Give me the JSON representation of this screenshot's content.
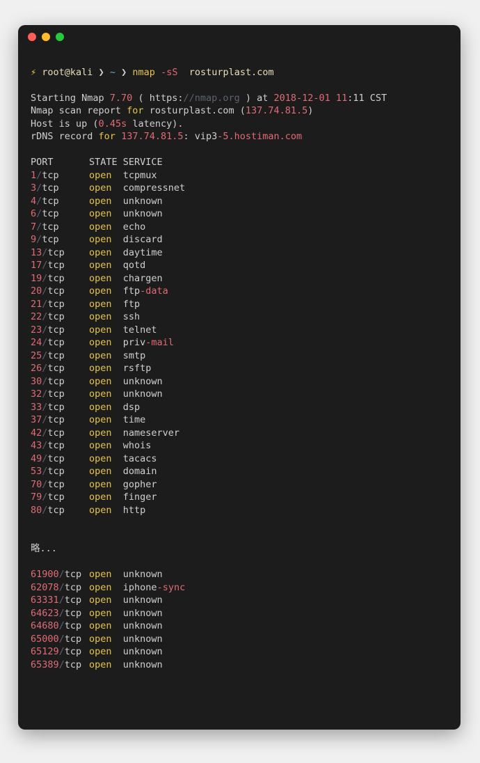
{
  "prompt": {
    "bolt": "⚡",
    "userhost": "root@kali",
    "sep1": "❯",
    "cwd": "~",
    "sep2": "❯",
    "cmd_base": "nmap",
    "cmd_flag": "-sS",
    "cmd_target": "rosturplast.com"
  },
  "header": {
    "l1a": "Starting Nmap ",
    "l1b": "7.70",
    "l1c": " ( https:",
    "l1d": "//nmap.org",
    "l1e": " ) at ",
    "l1f": "2018-12-01 11",
    "l1g": ":11 CST",
    "l2a": "Nmap scan report ",
    "l2b": "for",
    "l2c": " rosturplast.com (",
    "l2d": "137.74.81.5",
    "l2e": ")",
    "l3a": "Host is up (",
    "l3b": "0",
    "l3c": ".45s",
    "l3d": " latency).",
    "l4a": "rDNS record ",
    "l4b": "for",
    "l4c": " ",
    "l4d": "137.74.81.5",
    "l4e": ": vip3",
    "l4f": "-5.hostiman.com"
  },
  "columns": {
    "port": "PORT",
    "state": "STATE",
    "service": "SERVICE"
  },
  "ports_top": [
    {
      "num": "1",
      "proto": "tcp",
      "state": "open",
      "service": "tcpmux"
    },
    {
      "num": "3",
      "proto": "tcp",
      "state": "open",
      "service": "compressnet"
    },
    {
      "num": "4",
      "proto": "tcp",
      "state": "open",
      "service": "unknown"
    },
    {
      "num": "6",
      "proto": "tcp",
      "state": "open",
      "service": "unknown"
    },
    {
      "num": "7",
      "proto": "tcp",
      "state": "open",
      "service": "echo"
    },
    {
      "num": "9",
      "proto": "tcp",
      "state": "open",
      "service": "discard"
    },
    {
      "num": "13",
      "proto": "tcp",
      "state": "open",
      "service": "daytime"
    },
    {
      "num": "17",
      "proto": "tcp",
      "state": "open",
      "service": "qotd"
    },
    {
      "num": "19",
      "proto": "tcp",
      "state": "open",
      "service": "chargen"
    },
    {
      "num": "20",
      "proto": "tcp",
      "state": "open",
      "service": "ftp-data",
      "svc_a": "ftp",
      "svc_b": "-data"
    },
    {
      "num": "21",
      "proto": "tcp",
      "state": "open",
      "service": "ftp"
    },
    {
      "num": "22",
      "proto": "tcp",
      "state": "open",
      "service": "ssh"
    },
    {
      "num": "23",
      "proto": "tcp",
      "state": "open",
      "service": "telnet"
    },
    {
      "num": "24",
      "proto": "tcp",
      "state": "open",
      "service": "priv-mail",
      "svc_a": "priv",
      "svc_b": "-mail"
    },
    {
      "num": "25",
      "proto": "tcp",
      "state": "open",
      "service": "smtp"
    },
    {
      "num": "26",
      "proto": "tcp",
      "state": "open",
      "service": "rsftp"
    },
    {
      "num": "30",
      "proto": "tcp",
      "state": "open",
      "service": "unknown"
    },
    {
      "num": "32",
      "proto": "tcp",
      "state": "open",
      "service": "unknown"
    },
    {
      "num": "33",
      "proto": "tcp",
      "state": "open",
      "service": "dsp"
    },
    {
      "num": "37",
      "proto": "tcp",
      "state": "open",
      "service": "time"
    },
    {
      "num": "42",
      "proto": "tcp",
      "state": "open",
      "service": "nameserver"
    },
    {
      "num": "43",
      "proto": "tcp",
      "state": "open",
      "service": "whois"
    },
    {
      "num": "49",
      "proto": "tcp",
      "state": "open",
      "service": "tacacs"
    },
    {
      "num": "53",
      "proto": "tcp",
      "state": "open",
      "service": "domain"
    },
    {
      "num": "70",
      "proto": "tcp",
      "state": "open",
      "service": "gopher"
    },
    {
      "num": "79",
      "proto": "tcp",
      "state": "open",
      "service": "finger"
    },
    {
      "num": "80",
      "proto": "tcp",
      "state": "open",
      "service": "http"
    }
  ],
  "ellipsis": "略...",
  "ports_bottom": [
    {
      "num": "61900",
      "proto": "tcp",
      "state": "open",
      "service": "unknown"
    },
    {
      "num": "62078",
      "proto": "tcp",
      "state": "open",
      "service": "iphone-sync",
      "svc_a": "iphone",
      "svc_b": "-sync"
    },
    {
      "num": "63331",
      "proto": "tcp",
      "state": "open",
      "service": "unknown"
    },
    {
      "num": "64623",
      "proto": "tcp",
      "state": "open",
      "service": "unknown"
    },
    {
      "num": "64680",
      "proto": "tcp",
      "state": "open",
      "service": "unknown"
    },
    {
      "num": "65000",
      "proto": "tcp",
      "state": "open",
      "service": "unknown"
    },
    {
      "num": "65129",
      "proto": "tcp",
      "state": "open",
      "service": "unknown"
    },
    {
      "num": "65389",
      "proto": "tcp",
      "state": "open",
      "service": "unknown"
    }
  ]
}
